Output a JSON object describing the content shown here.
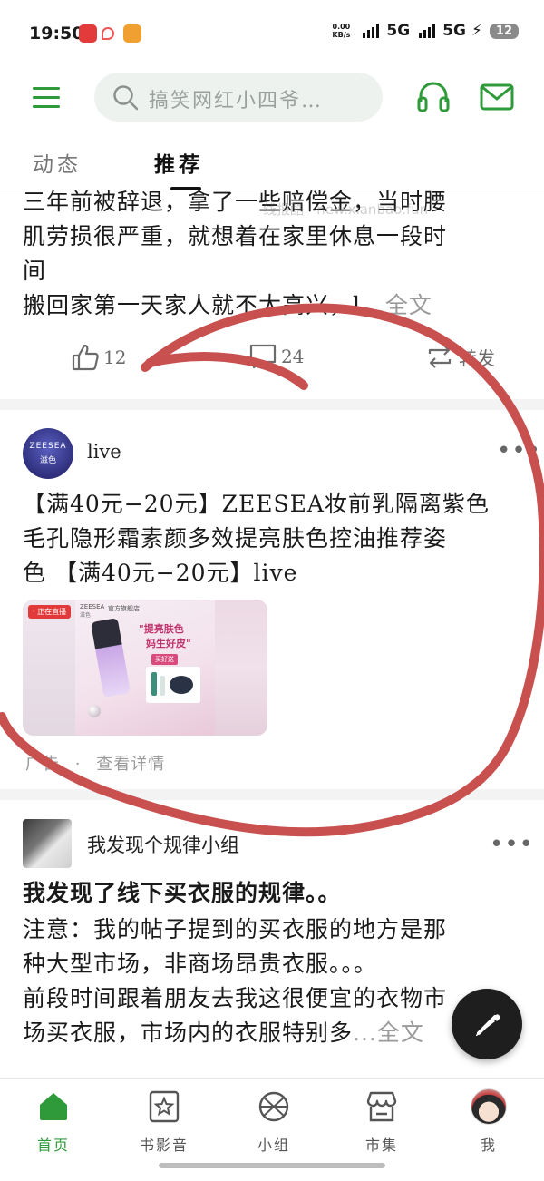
{
  "status_bar": {
    "time": "19:50",
    "net_speed_value": "0.00",
    "net_speed_unit": "KB/s",
    "signal_1": "5G",
    "signal_2": "5G",
    "battery": "12"
  },
  "header": {
    "search_placeholder": "搞笑网红小四爷…",
    "accent_color": "#2f9a3a"
  },
  "tabs": [
    {
      "label": "动态",
      "active": false
    },
    {
      "label": "推荐",
      "active": true
    }
  ],
  "post1": {
    "lines": [
      "三年前被辞退，拿了一些赔偿金，当时腰",
      "肌劳损很严重，就想着在家里休息一段时",
      "间"
    ],
    "last_line": "搬回家第一天家人就不太高兴，l",
    "more_label": "...全文",
    "likes": "12",
    "comments": "24",
    "repost_label": "转发",
    "watermark": "线报酷 · new.xianbao.fun"
  },
  "ad_post": {
    "poster_name": "live",
    "avatar_text_top": "ZEESEA",
    "avatar_text_bottom": "滋色",
    "lines": [
      "【满40元−20元】ZEESEA妆前乳隔离紫色",
      "毛孔隐形霜素颜多效提亮肤色控油推荐姿",
      "色 【满40元−20元】live"
    ],
    "image": {
      "live_badge": "· 正在直播",
      "brand": "ZEESEA",
      "brand_sub": "滋色",
      "store": "官方旗舰店",
      "headline_1": "\"提亮肤色",
      "headline_2": "妈生好皮\"",
      "buy_label": "买好送"
    },
    "ad_label": "广告",
    "dot": "·",
    "details_label": "查看详情"
  },
  "post3": {
    "group_name": "我发现个规律小组",
    "title": "我发现了线下买衣服的规律。。",
    "lines": [
      "注意：我的帖子提到的买衣服的地方是那",
      "种大型市场，非商场昂贵衣服。。。",
      "前段时间跟着朋友去我这很便宜的衣物市"
    ],
    "last_line": "场买衣服，市场内的衣服特别多",
    "more_label": "...全文"
  },
  "bottom_nav": [
    {
      "label": "首页",
      "icon": "home-icon",
      "active": true
    },
    {
      "label": "书影音",
      "icon": "media-card-icon",
      "active": false
    },
    {
      "label": "小组",
      "icon": "group-ball-icon",
      "active": false
    },
    {
      "label": "市集",
      "icon": "market-store-icon",
      "active": false
    },
    {
      "label": "我",
      "icon": "profile-avatar",
      "active": false
    }
  ]
}
